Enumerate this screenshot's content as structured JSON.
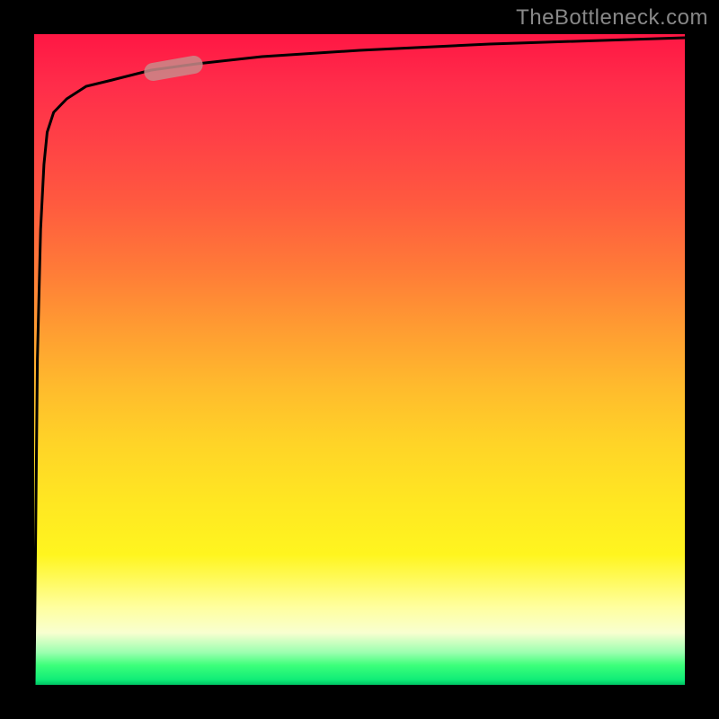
{
  "watermark": "TheBottleneck.com",
  "chart_data": {
    "type": "line",
    "title": "",
    "xlabel": "",
    "ylabel": "",
    "ylim": [
      0,
      100
    ],
    "xlim": [
      0,
      100
    ],
    "series": [
      {
        "name": "bottleneck-curve",
        "x": [
          0,
          0.5,
          1,
          1.5,
          2,
          3,
          5,
          8,
          12,
          18,
          25,
          35,
          50,
          70,
          100
        ],
        "y": [
          0,
          50,
          70,
          80,
          85,
          88,
          90,
          92,
          93,
          94.5,
          95.5,
          96.5,
          97.5,
          98.5,
          99.5
        ]
      }
    ],
    "gradient_stops": [
      {
        "pct": 0,
        "color": "#ff1744"
      },
      {
        "pct": 26,
        "color": "#ff5a3f"
      },
      {
        "pct": 54,
        "color": "#ffba2d"
      },
      {
        "pct": 80,
        "color": "#fff51f"
      },
      {
        "pct": 92,
        "color": "#f8ffd0"
      },
      {
        "pct": 100,
        "color": "#00e676"
      }
    ],
    "highlight_segment": {
      "x_start": 18,
      "x_end": 25
    },
    "grid": false,
    "legend": false
  }
}
